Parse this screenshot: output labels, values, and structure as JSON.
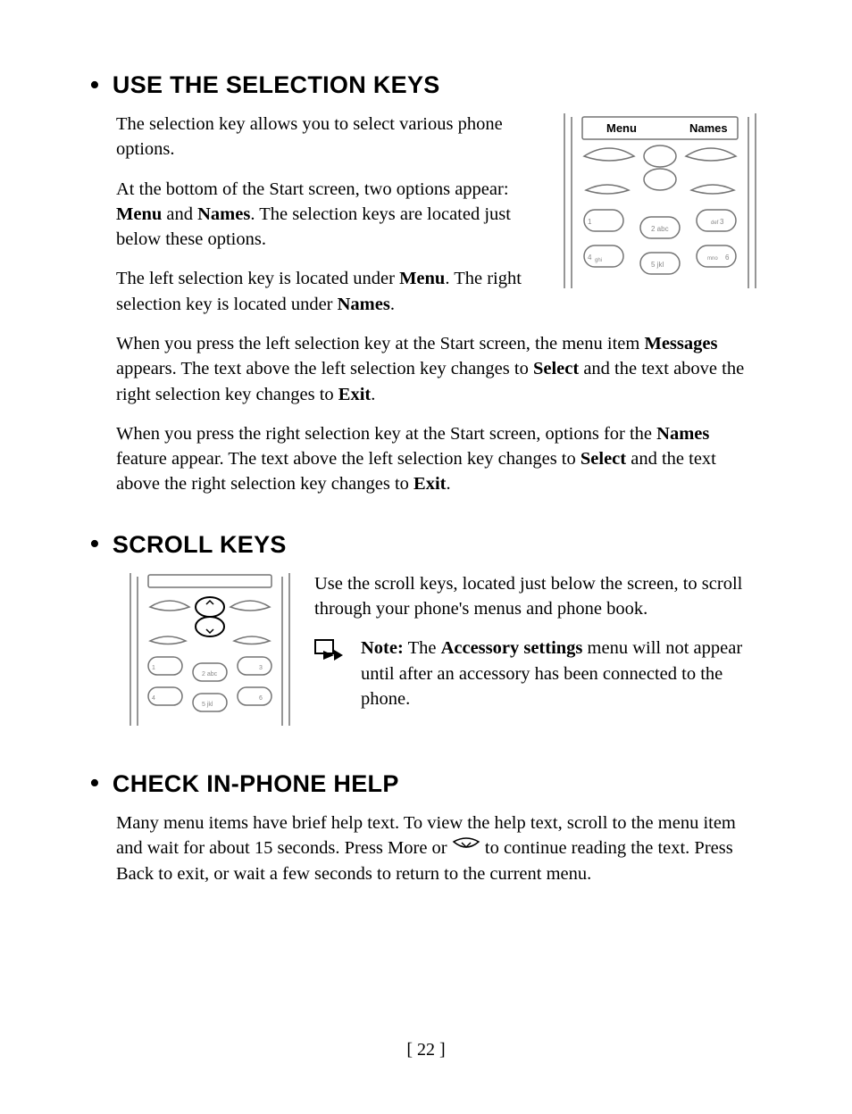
{
  "page_number": "[ 22 ]",
  "sections": [
    {
      "heading": "USE THE SELECTION KEYS",
      "p1": "The selection key allows you to select various phone options.",
      "p2_a": "At the bottom of the Start screen, two options appear: ",
      "p2_b": "Menu",
      "p2_c": " and ",
      "p2_d": "Names",
      "p2_e": ". The selection keys are located just below these options.",
      "p3_a": "The left selection key is located under ",
      "p3_b": "Menu",
      "p3_c": ". The right selection key is located under ",
      "p3_d": "Names",
      "p3_e": ".",
      "p4_a": "When you press the left selection key at the Start screen, the menu item ",
      "p4_b": "Messages",
      "p4_c": " appears. The text above the left selection key changes to ",
      "p4_d": "Select",
      "p4_e": " and the text above the right selection key changes to ",
      "p4_f": "Exit",
      "p4_g": ".",
      "p5_a": "When you press the right selection key at the Start screen, options for the ",
      "p5_b": "Names",
      "p5_c": " feature appear. The text above the left selection key changes to ",
      "p5_d": "Select",
      "p5_e": " and the text above the right selection key changes to ",
      "p5_f": "Exit",
      "p5_g": ".",
      "fig": {
        "menu_label": "Menu",
        "names_label": "Names"
      }
    },
    {
      "heading": "SCROLL KEYS",
      "p1": "Use the scroll keys, located just below the screen, to scroll through your phone's menus and phone book.",
      "note_label": "Note:",
      "note_a": " The ",
      "note_b": "Accessory settings",
      "note_c": " menu will not appear until after an accessory has been connected to the phone."
    },
    {
      "heading": "CHECK IN-PHONE HELP",
      "p1_a": "Many menu items have brief help text. To view the help text, scroll to the menu item and wait for about 15 seconds. Press More or ",
      "p1_b": " to continue reading the text. Press Back to exit, or wait a few seconds to return to the current menu."
    }
  ]
}
